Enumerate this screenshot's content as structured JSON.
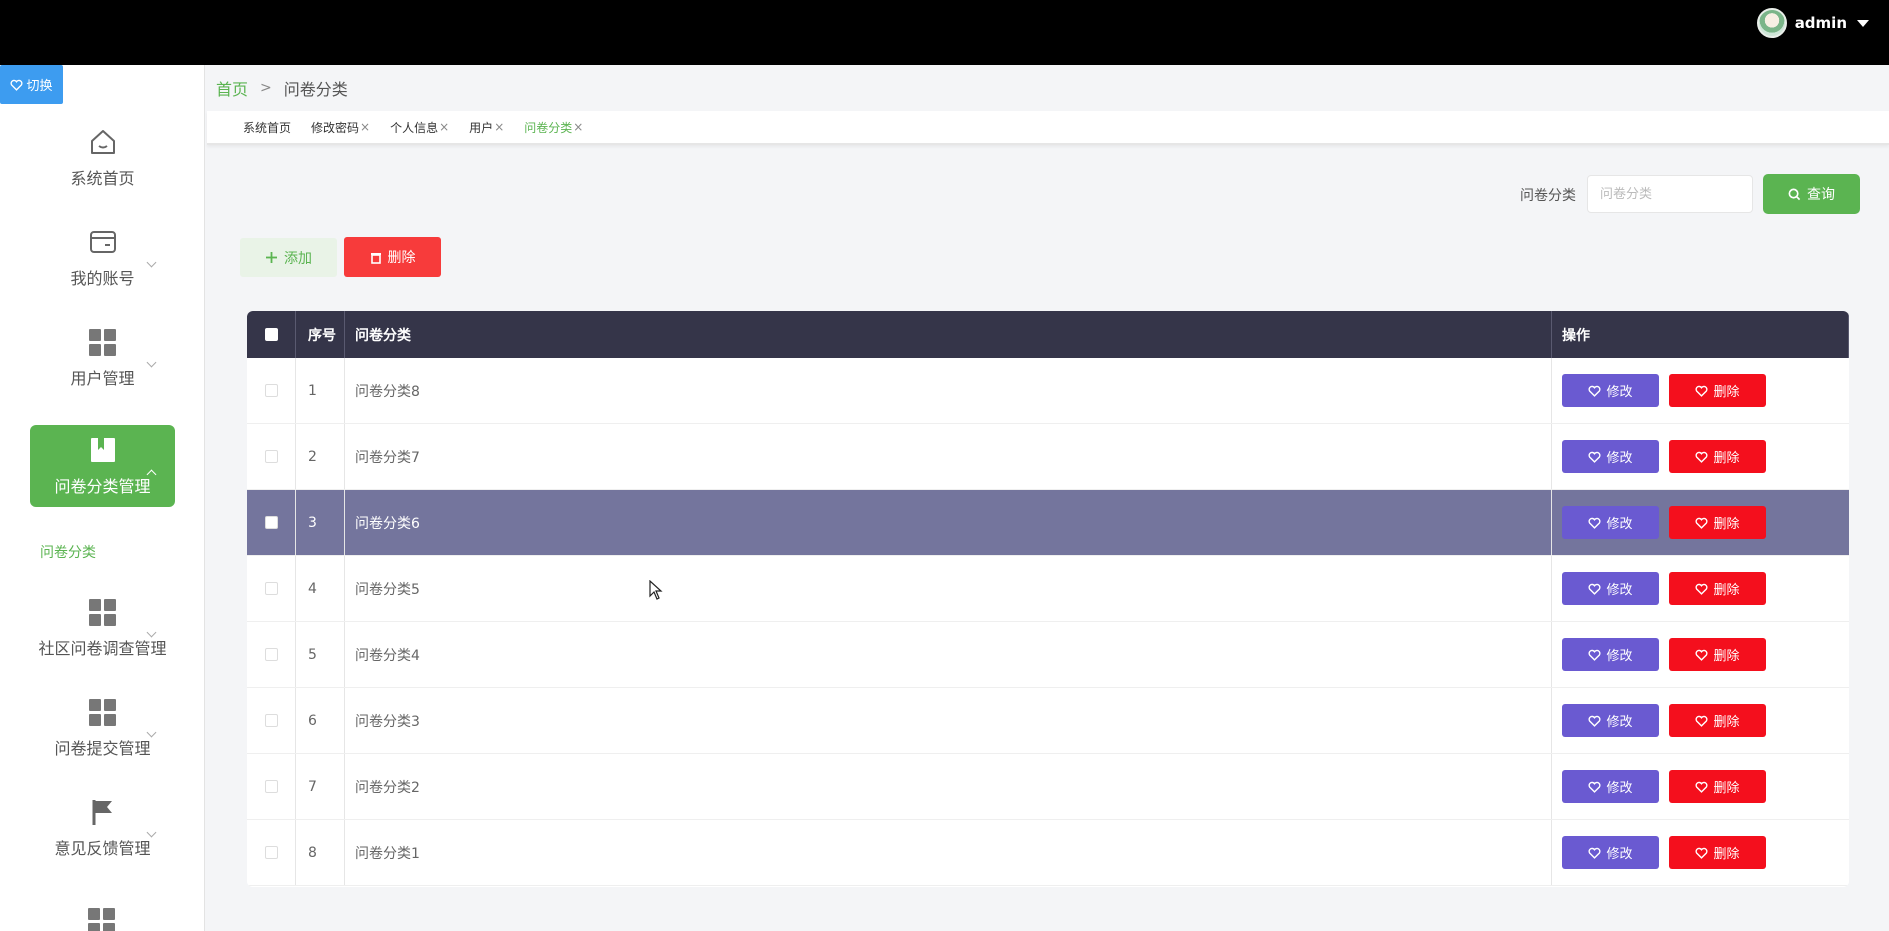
{
  "topbar": {
    "username": "admin"
  },
  "sidebar": {
    "switch_label": "切换",
    "items": [
      {
        "label": "系统首页",
        "icon": "home-icon"
      },
      {
        "label": "我的账号",
        "icon": "wallet-icon"
      },
      {
        "label": "用户管理",
        "icon": "grid-icon"
      },
      {
        "label": "问卷分类管理",
        "icon": "book-icon"
      },
      {
        "label": "社区问卷调查管理",
        "icon": "grid-icon"
      },
      {
        "label": "问卷提交管理",
        "icon": "grid-icon"
      },
      {
        "label": "意见反馈管理",
        "icon": "flag-icon"
      }
    ],
    "sub_item": "问卷分类"
  },
  "breadcrumb": {
    "home": "首页",
    "separator": ">",
    "current": "问卷分类"
  },
  "tabs": [
    {
      "label": "系统首页",
      "closable": false
    },
    {
      "label": "修改密码",
      "closable": true
    },
    {
      "label": "个人信息",
      "closable": true
    },
    {
      "label": "用户",
      "closable": true
    },
    {
      "label": "问卷分类",
      "closable": true
    }
  ],
  "tab_close": "×",
  "search": {
    "label": "问卷分类",
    "placeholder": "问卷分类",
    "button": "查询"
  },
  "actions": {
    "add": "添加",
    "delete": "删除"
  },
  "table": {
    "headers": {
      "no": "序号",
      "name": "问卷分类",
      "ops": "操作"
    },
    "rows": [
      {
        "no": "1",
        "name": "问卷分类8"
      },
      {
        "no": "2",
        "name": "问卷分类7"
      },
      {
        "no": "3",
        "name": "问卷分类6"
      },
      {
        "no": "4",
        "name": "问卷分类5"
      },
      {
        "no": "5",
        "name": "问卷分类4"
      },
      {
        "no": "6",
        "name": "问卷分类3"
      },
      {
        "no": "7",
        "name": "问卷分类2"
      },
      {
        "no": "8",
        "name": "问卷分类1"
      }
    ],
    "edit_label": "修改",
    "delete_label": "删除",
    "highlighted_row": 2
  },
  "colors": {
    "accent": "#5bb451",
    "header": "#353549",
    "edit": "#6a5ad1",
    "danger": "#f40f1d",
    "highlight": "#74759d"
  }
}
